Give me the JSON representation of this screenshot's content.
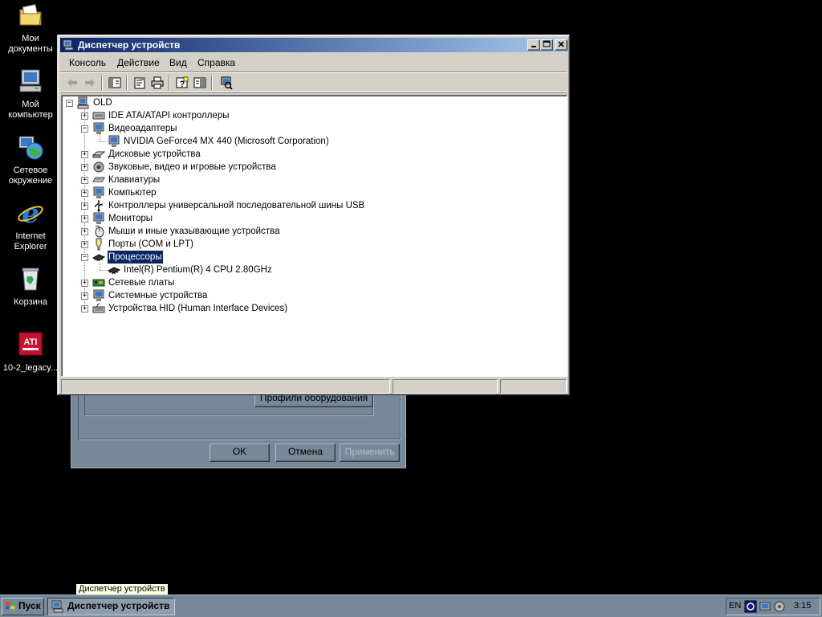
{
  "desktop": {
    "icons": [
      {
        "label1": "Мои",
        "label2": "документы"
      },
      {
        "label1": "Мой",
        "label2": "компьютер"
      },
      {
        "label1": "Сетевое",
        "label2": "окружение"
      },
      {
        "label1": "Internet",
        "label2": "Explorer"
      },
      {
        "label1": "Корзина",
        "label2": ""
      },
      {
        "label1": "10-2_legacy...",
        "label2": ""
      }
    ],
    "ati_logo_text": "ATI"
  },
  "bg_dialog": {
    "profiles_button": "Профили оборудования",
    "ok_button": "OK",
    "cancel_button": "Отмена",
    "apply_button": "Применить"
  },
  "window": {
    "title": "Диспетчер устройств",
    "menu": [
      "Консоль",
      "Действие",
      "Вид",
      "Справка"
    ],
    "toolbar_icons": [
      "back-arrow-icon",
      "forward-arrow-icon",
      "show-hide-tree-icon",
      "properties-icon",
      "print-icon",
      "help-icon",
      "show-hide-action-pane-icon",
      "scan-hardware-icon"
    ]
  },
  "tree": {
    "root": "OLD",
    "nodes": [
      {
        "label": "IDE ATA/ATAPI контроллеры",
        "level": 1,
        "expanded": false
      },
      {
        "label": "Видеоадаптеры",
        "level": 1,
        "expanded": true
      },
      {
        "label": "NVIDIA GeForce4 MX 440 (Microsoft Corporation)",
        "level": 2
      },
      {
        "label": "Дисковые устройства",
        "level": 1,
        "expanded": false
      },
      {
        "label": "Звуковые, видео и игровые устройства",
        "level": 1,
        "expanded": false
      },
      {
        "label": "Клавиатуры",
        "level": 1,
        "expanded": false
      },
      {
        "label": "Компьютер",
        "level": 1,
        "expanded": false
      },
      {
        "label": "Контроллеры универсальной последовательной шины USB",
        "level": 1,
        "expanded": false
      },
      {
        "label": "Мониторы",
        "level": 1,
        "expanded": false
      },
      {
        "label": "Мыши и иные указывающие устройства",
        "level": 1,
        "expanded": false
      },
      {
        "label": "Порты (COM и LPT)",
        "level": 1,
        "expanded": false
      },
      {
        "label": "Процессоры",
        "level": 1,
        "expanded": true,
        "selected": true
      },
      {
        "label": "Intel(R) Pentium(R) 4 CPU 2.80GHz",
        "level": 2
      },
      {
        "label": "Сетевые платы",
        "level": 1,
        "expanded": false
      },
      {
        "label": "Системные устройства",
        "level": 1,
        "expanded": false
      },
      {
        "label": "Устройства HID (Human Interface Devices)",
        "level": 1,
        "expanded": false
      }
    ]
  },
  "tooltip": "Диспетчер устройств",
  "taskbar": {
    "start_label": "Пуск",
    "task_label": "Диспетчер устройств",
    "tray_lang": "EN",
    "clock": "3:15"
  },
  "colors": {
    "titlebar_start": "#0a246a",
    "titlebar_end": "#a6caf0",
    "selection": "#0a246a",
    "taskbar": "#778899"
  }
}
